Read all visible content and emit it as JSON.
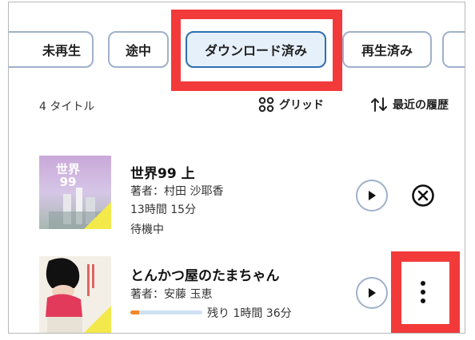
{
  "filters": [
    {
      "label": "未再生",
      "active": false
    },
    {
      "label": "途中",
      "active": false
    },
    {
      "label": "ダウンロード済み",
      "active": true
    },
    {
      "label": "再生済み",
      "active": false
    }
  ],
  "toolbar": {
    "count": "4 タイトル",
    "grid_label": "グリッド",
    "sort_label": "最近の履歴"
  },
  "items": [
    {
      "title": "世界99 上",
      "author": "著者：村田 沙耶香",
      "duration": "13時間 15分",
      "status": "待機中",
      "cover_text": "世界99"
    },
    {
      "title": "とんかつ屋のたまちゃん",
      "author": "著者：安藤 玉恵",
      "remaining": "残り 1時間 36分",
      "progress": 0.12
    }
  ],
  "colors": {
    "accent": "#2f6fb1",
    "highlight": "#f23a3a",
    "progress": "#f0892c"
  }
}
